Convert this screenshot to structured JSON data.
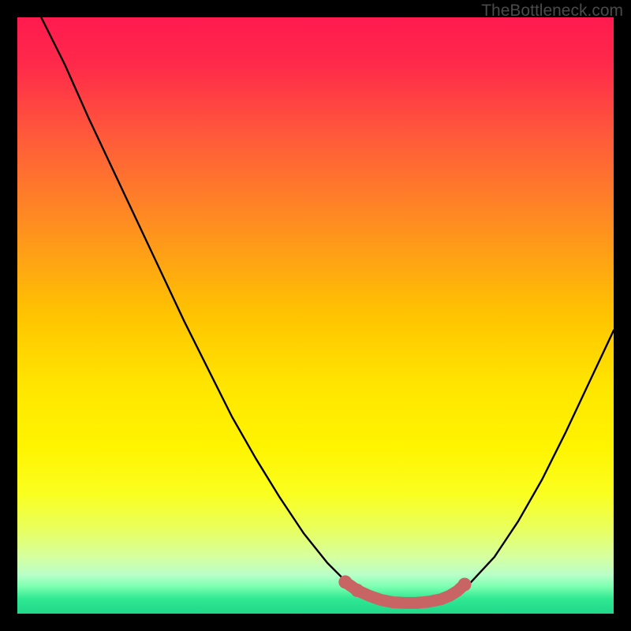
{
  "watermark": "TheBottleneck.com",
  "colors": {
    "gradient_stops": [
      {
        "offset": 0.0,
        "color": "#ff1a4f"
      },
      {
        "offset": 0.08,
        "color": "#ff2a4a"
      },
      {
        "offset": 0.2,
        "color": "#ff5a3a"
      },
      {
        "offset": 0.35,
        "color": "#ff8f20"
      },
      {
        "offset": 0.5,
        "color": "#ffc400"
      },
      {
        "offset": 0.62,
        "color": "#ffe600"
      },
      {
        "offset": 0.72,
        "color": "#fff400"
      },
      {
        "offset": 0.8,
        "color": "#faff20"
      },
      {
        "offset": 0.86,
        "color": "#e8ff60"
      },
      {
        "offset": 0.905,
        "color": "#d6ffa0"
      },
      {
        "offset": 0.935,
        "color": "#b8ffc8"
      },
      {
        "offset": 0.955,
        "color": "#7affb0"
      },
      {
        "offset": 0.975,
        "color": "#30e892"
      },
      {
        "offset": 1.0,
        "color": "#1fd88a"
      }
    ],
    "curve": "#000000",
    "marker": "#c96464"
  },
  "chart_data": {
    "type": "line",
    "title": "",
    "xlabel": "",
    "ylabel": "",
    "xlim": [
      0,
      100
    ],
    "ylim": [
      0,
      100
    ],
    "series": [
      {
        "name": "bottleneck-curve",
        "x": [
          4,
          8,
          12,
          16,
          20,
          24,
          28,
          32,
          36,
          40,
          44,
          48,
          52,
          55,
          58,
          61,
          64,
          67,
          70,
          73,
          76,
          80,
          84,
          88,
          92,
          96,
          100
        ],
        "y": [
          100,
          92,
          83,
          74.5,
          66,
          57.5,
          49,
          41,
          33,
          26,
          19.5,
          13.5,
          8.5,
          5.5,
          3.5,
          2.3,
          1.8,
          1.8,
          2.2,
          3.2,
          5.2,
          9.5,
          15.5,
          22.5,
          30.5,
          39,
          47.5
        ]
      }
    ],
    "markers": {
      "name": "highlight-segment",
      "x": [
        55,
        57,
        59,
        61,
        63,
        65,
        67,
        69,
        71,
        72.5,
        73.8,
        75
      ],
      "y": [
        5.3,
        3.9,
        3.0,
        2.3,
        1.9,
        1.8,
        1.8,
        2.0,
        2.4,
        3.0,
        3.8,
        4.9
      ]
    }
  }
}
